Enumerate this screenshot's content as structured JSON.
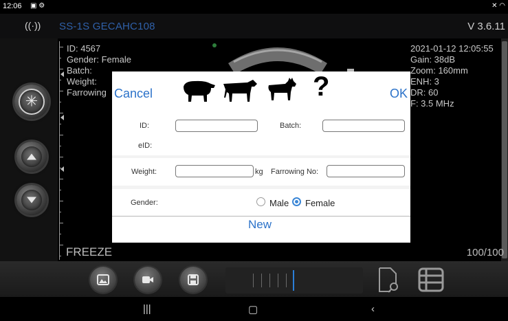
{
  "status": {
    "time": "12:06"
  },
  "title": {
    "device": "SS-1S GECAHC108",
    "version": "V 3.6.11"
  },
  "left_info": [
    "ID: 4567",
    "Gender: Female",
    "Batch:",
    "Weight:",
    "Farrowing"
  ],
  "right_info": [
    "2021-01-12 12:05:55",
    "Gain: 38dB",
    "Zoom: 160mm",
    "ENH: 3",
    "DR: 60",
    "F: 3.5 MHz"
  ],
  "freeze_label": "FREEZE",
  "frame_count": "100/100",
  "dialog": {
    "cancel": "Cancel",
    "ok": "OK",
    "question_mark": "?",
    "id_label": "ID:",
    "batch_label": "Batch:",
    "eid_label": "eID:",
    "weight_label": "Weight:",
    "weight_unit": "kg",
    "farrowing_label": "Farrowing No:",
    "gender_label": "Gender:",
    "male_label": "Male",
    "female_label": "Female",
    "gender_selected": "Female",
    "new_label": "New",
    "id_value": "",
    "batch_value": "",
    "weight_value": "",
    "farrowing_value": "",
    "animals": [
      "pig-icon",
      "cow-icon",
      "goat-icon"
    ]
  },
  "colors": {
    "accent": "#2b72c9",
    "radio": "#3a86d6",
    "device_title": "#2f60a8"
  }
}
